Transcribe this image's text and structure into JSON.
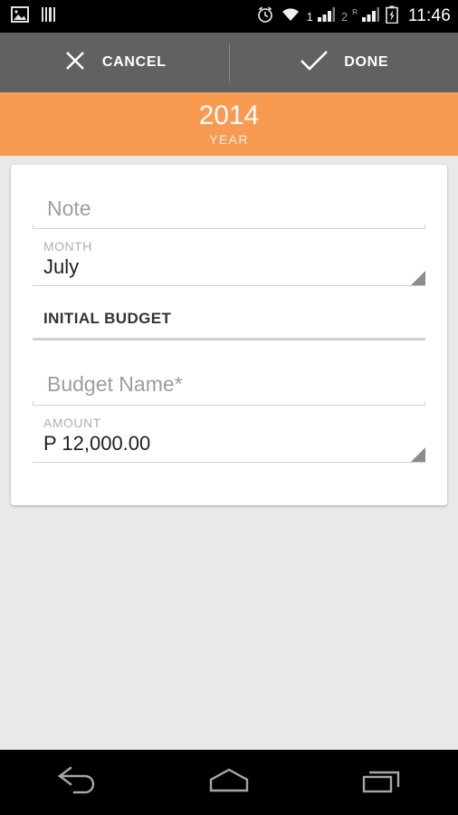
{
  "status_bar": {
    "icons": [
      "image-icon",
      "barcode-icon",
      "alarm-clock-icon",
      "wifi-icon",
      "signal-sim1-icon",
      "signal-sim2-icon",
      "battery-charging-icon"
    ],
    "sim1_label": "1",
    "sim2_label": "2",
    "roaming_label": "R",
    "clock": "11:46"
  },
  "action_bar": {
    "cancel_label": "CANCEL",
    "done_label": "DONE"
  },
  "header": {
    "year_value": "2014",
    "year_caption": "YEAR",
    "accent_color": "#f89a50"
  },
  "form": {
    "note": {
      "placeholder": "Note",
      "value": ""
    },
    "month": {
      "label": "MONTH",
      "value": "July"
    },
    "section": {
      "title": "INITIAL BUDGET"
    },
    "budget_name": {
      "placeholder": "Budget Name*",
      "value": ""
    },
    "amount": {
      "label": "AMOUNT",
      "value": "P 12,000.00"
    }
  },
  "nav_bar": {
    "back_label": "back-icon",
    "home_label": "home-icon",
    "recents_label": "recents-icon"
  }
}
